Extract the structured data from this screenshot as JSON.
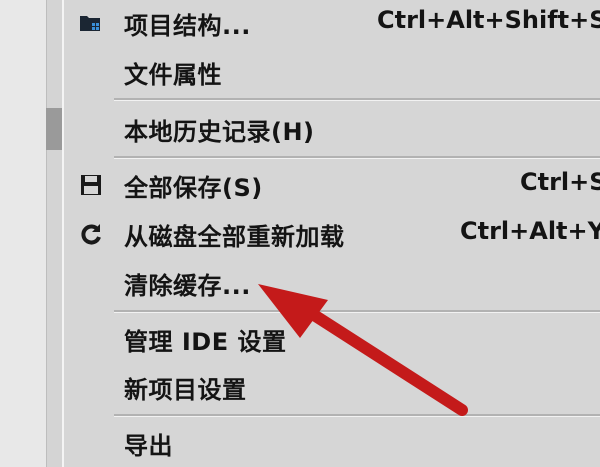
{
  "menu": {
    "items": [
      {
        "label": "项目结构...",
        "shortcut": "Ctrl+Alt+Shift+S",
        "icon": "project-structure-icon"
      },
      {
        "label": "文件属性",
        "shortcut": ""
      },
      {
        "label": "本地历史记录(H)",
        "shortcut": ""
      },
      {
        "label": "全部保存(S)",
        "shortcut": "Ctrl+S",
        "icon": "save-all-icon"
      },
      {
        "label": "从磁盘全部重新加载",
        "shortcut": "Ctrl+Alt+Y",
        "icon": "reload-icon"
      },
      {
        "label": "清除缓存...",
        "shortcut": ""
      },
      {
        "label": "管理 IDE 设置",
        "shortcut": ""
      },
      {
        "label": "新项目设置",
        "shortcut": ""
      },
      {
        "label": "导出",
        "shortcut": ""
      }
    ]
  },
  "annotation": {
    "arrow_color": "#c41a1a"
  }
}
